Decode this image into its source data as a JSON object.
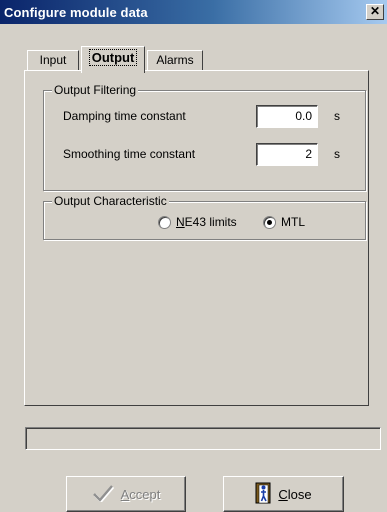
{
  "window": {
    "title": "Configure module data",
    "close_symbol": "✕"
  },
  "tabs": [
    {
      "label": "Input",
      "active": false
    },
    {
      "label": "Output",
      "active": true
    },
    {
      "label": "Alarms",
      "active": false
    }
  ],
  "output_filtering": {
    "legend": "Output Filtering",
    "damping": {
      "label": "Damping time constant",
      "value": "0.0",
      "unit": "s"
    },
    "smoothing": {
      "label": "Smoothing time constant",
      "value": "2",
      "unit": "s"
    }
  },
  "output_characteristic": {
    "legend": "Output Characteristic",
    "options": [
      {
        "label_hot": "N",
        "label_rest": "E43 limits",
        "selected": false
      },
      {
        "label": "MTL",
        "selected": true
      }
    ]
  },
  "progress": {
    "value": 0
  },
  "buttons": {
    "accept": {
      "label_hot": "A",
      "label_rest": "ccept",
      "enabled": false,
      "icon": "checkmark-icon"
    },
    "close": {
      "label_hot": "C",
      "label_rest": "lose",
      "enabled": true,
      "icon": "door-person-icon"
    }
  },
  "colors": {
    "titlebar_start": "#0a246a",
    "titlebar_end": "#a6caf0",
    "face": "#d4d0c8"
  }
}
